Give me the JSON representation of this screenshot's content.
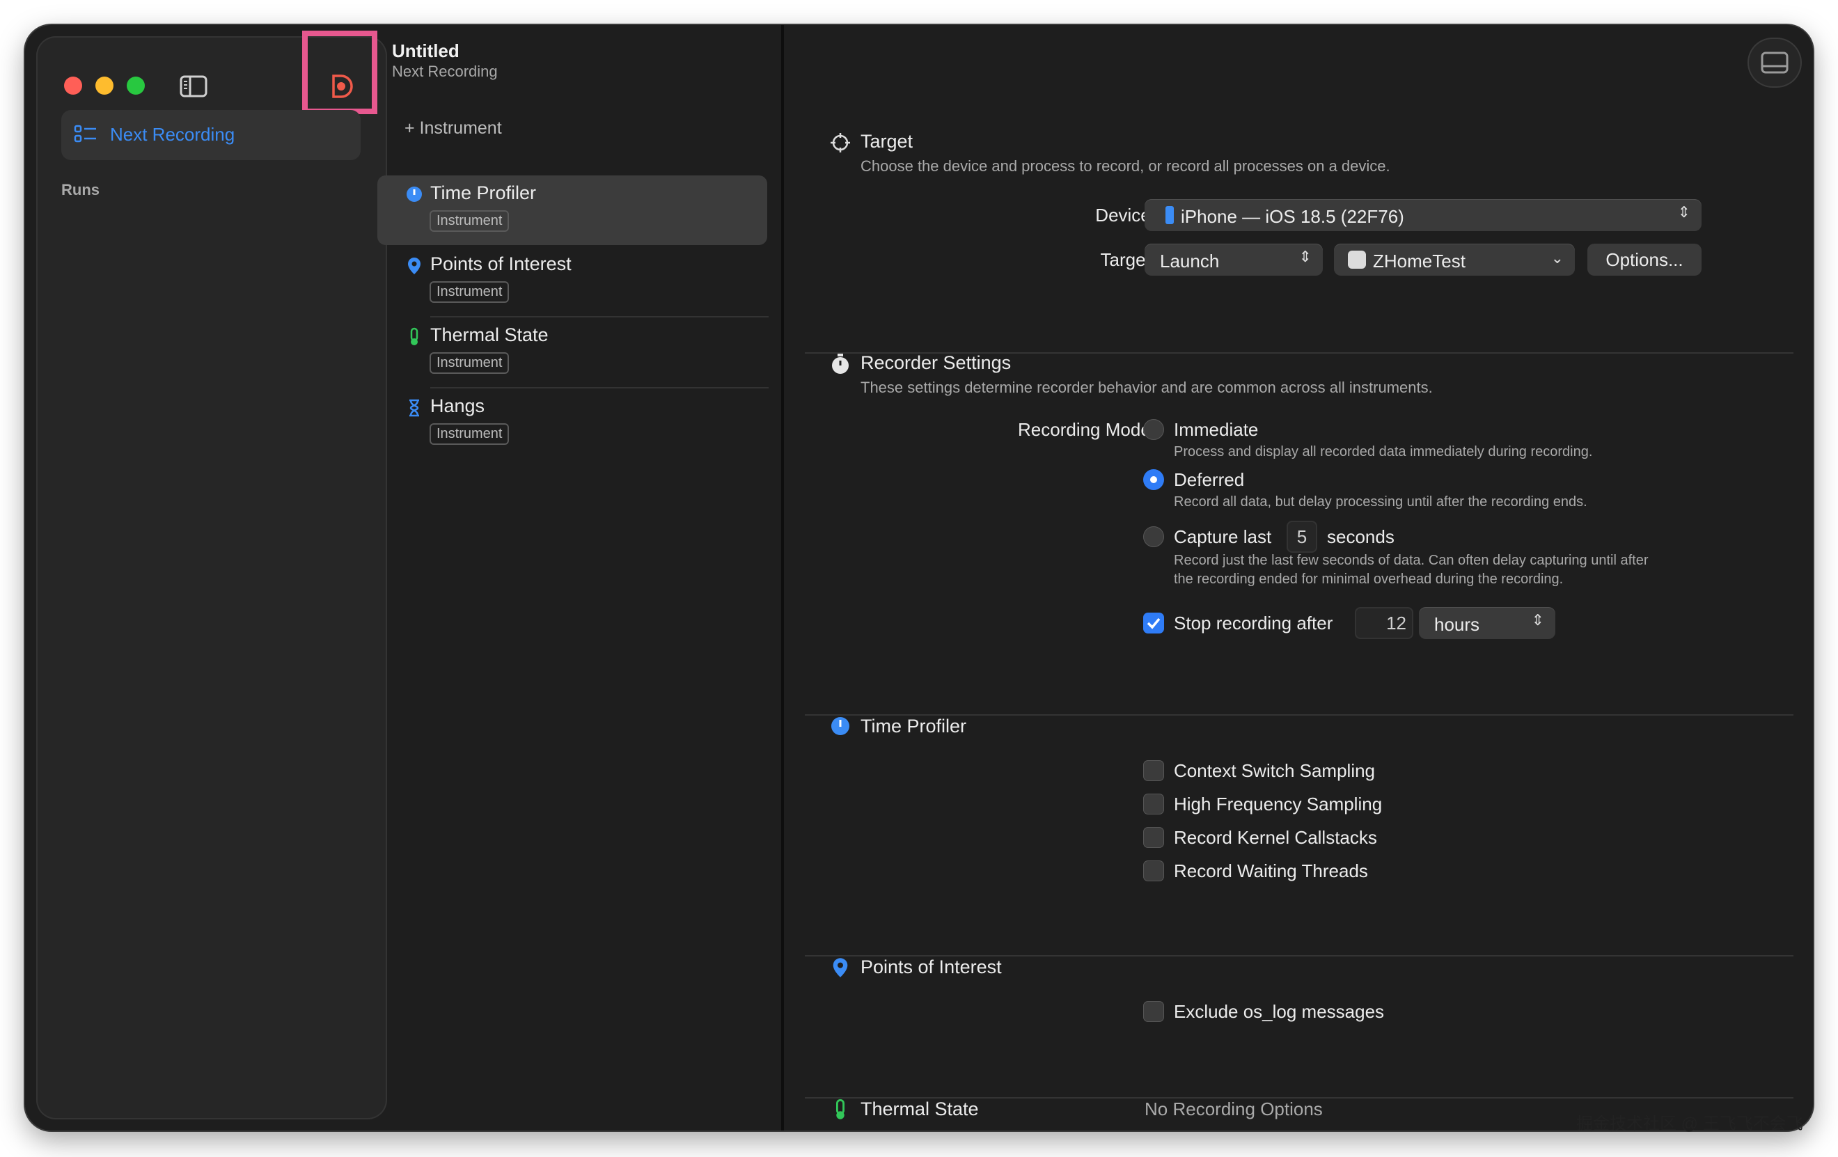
{
  "window": {
    "title": "Untitled",
    "subtitle": "Next Recording"
  },
  "sidebar": {
    "next_recording": "Next Recording",
    "runs_label": "Runs"
  },
  "instruments": {
    "add_label": "+ Instrument",
    "badge": "Instrument",
    "items": [
      {
        "name": "Time Profiler",
        "icon": "time-profiler-icon",
        "color": "#3b8cf5"
      },
      {
        "name": "Points of Interest",
        "icon": "pin-icon",
        "color": "#3b8cf5"
      },
      {
        "name": "Thermal State",
        "icon": "thermometer-icon",
        "color": "#32c759"
      },
      {
        "name": "Hangs",
        "icon": "hourglass-icon",
        "color": "#3b8cf5"
      }
    ]
  },
  "target": {
    "title": "Target",
    "desc": "Choose the device and process to record, or record all processes on a device.",
    "device_label": "Device:",
    "device_value": "iPhone — iOS 18.5 (22F76)",
    "target_label": "Target:",
    "target_mode": "Launch",
    "target_app": "ZHomeTest",
    "options_button": "Options..."
  },
  "recorder": {
    "title": "Recorder Settings",
    "desc": "These settings determine recorder behavior and are common across all instruments.",
    "mode_label": "Recording Mode:",
    "immediate": "Immediate",
    "immediate_desc": "Process and display all recorded data immediately during recording.",
    "deferred": "Deferred",
    "deferred_desc": "Record all data, but delay processing until after the recording ends.",
    "capture_last": "Capture last",
    "capture_value": "5",
    "capture_unit": "seconds",
    "capture_desc_1": "Record just the last few seconds of data. Can often delay capturing until after",
    "capture_desc_2": "the recording ended for minimal overhead during the recording.",
    "stop_label": "Stop recording after",
    "stop_value": "12",
    "stop_unit": "hours"
  },
  "time_profiler": {
    "title": "Time Profiler",
    "options": [
      "Context Switch Sampling",
      "High Frequency Sampling",
      "Record Kernel Callstacks",
      "Record Waiting Threads"
    ]
  },
  "poi": {
    "title": "Points of Interest",
    "option": "Exclude os_log messages"
  },
  "thermal": {
    "title": "Thermal State",
    "value": "No Recording Options"
  },
  "watermark": "掘金技术社区 @ 王飞飞不会飞",
  "colors": {
    "accent": "#2f7cf6",
    "highlight": "#e7588f",
    "record": "#f05a4a"
  }
}
